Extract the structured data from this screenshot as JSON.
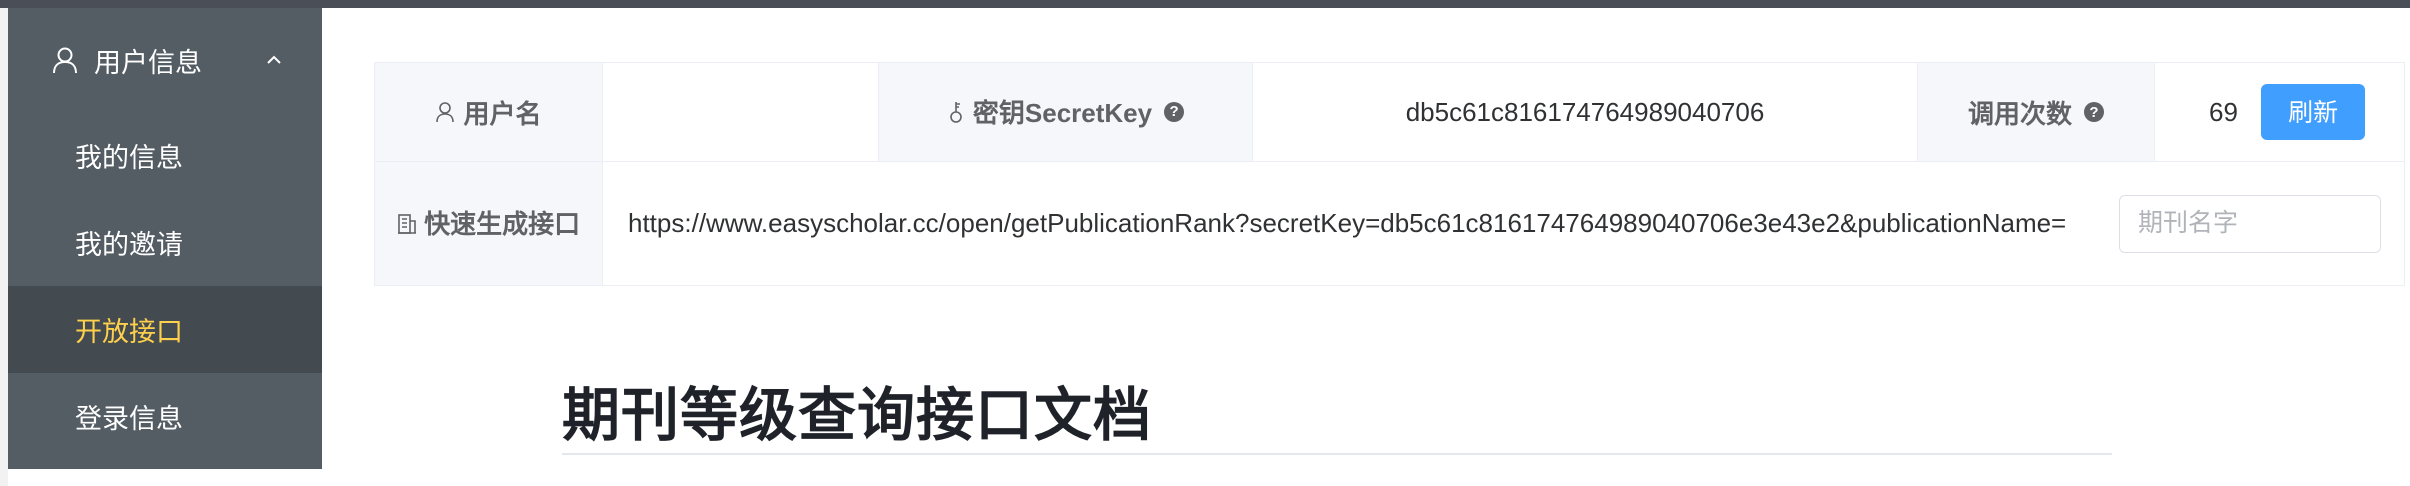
{
  "sidebar": {
    "parent": {
      "label": "用户信息",
      "icon": "user-icon",
      "expanded": true
    },
    "items": [
      {
        "label": "我的信息",
        "active": false
      },
      {
        "label": "我的邀请",
        "active": false
      },
      {
        "label": "开放接口",
        "active": true
      },
      {
        "label": "登录信息",
        "active": false
      }
    ],
    "colors": {
      "background": "#545c64",
      "active_background": "#434a50",
      "active_text": "#ffd04b"
    }
  },
  "info": {
    "username_label": "用户名",
    "username_value": "",
    "secretkey_label": "密钥SecretKey",
    "secretkey_value": "db5c61c816174764989040706",
    "calls_label": "调用次数",
    "calls_value": "69",
    "refresh_label": "刷新",
    "quick_label": "快速生成接口",
    "url_value": "https://www.easyscholar.cc/open/getPublicationRank?secretKey=db5c61c816174764989040706e3e43e2&publicationName=",
    "journal_placeholder": "期刊名字",
    "help_symbol": "?"
  },
  "doc": {
    "title": "期刊等级查询接口文档"
  },
  "colors": {
    "primary": "#409eff"
  }
}
